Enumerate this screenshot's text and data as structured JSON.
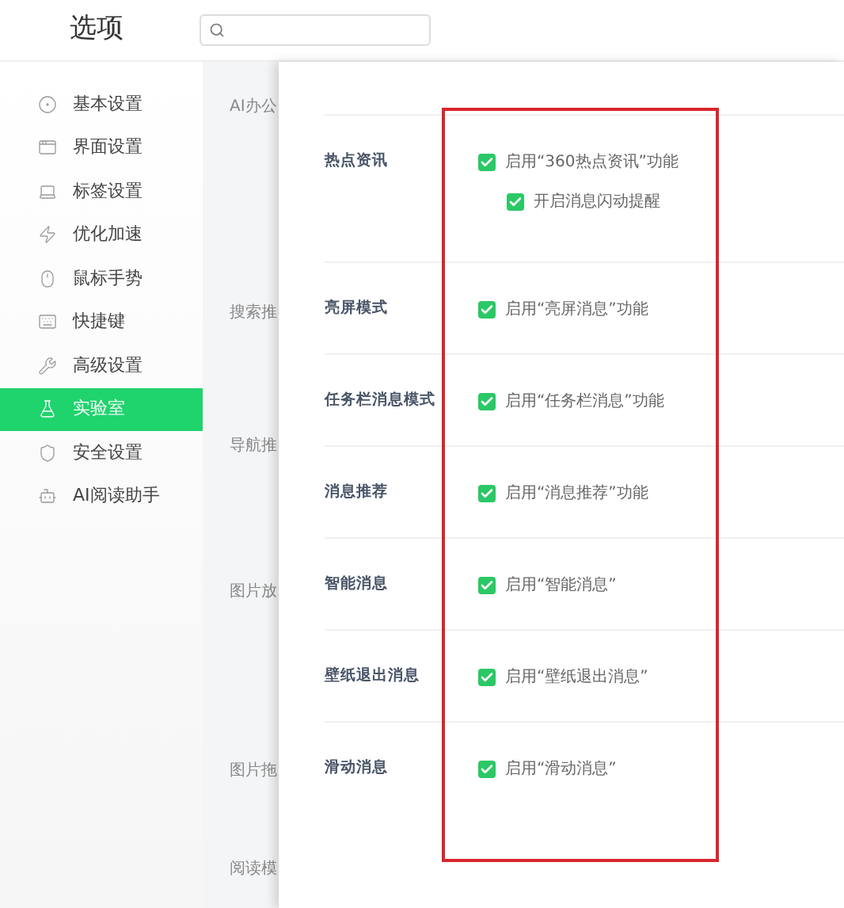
{
  "window": {
    "title": "选项"
  },
  "sidebar": {
    "items": [
      {
        "label": "基本设置",
        "selected": false
      },
      {
        "label": "界面设置",
        "selected": false
      },
      {
        "label": "标签设置",
        "selected": false
      },
      {
        "label": "优化加速",
        "selected": false
      },
      {
        "label": "鼠标手势",
        "selected": false
      },
      {
        "label": "快捷键",
        "selected": false
      },
      {
        "label": "高级设置",
        "selected": false
      },
      {
        "label": "实验室",
        "selected": true
      },
      {
        "label": "安全设置",
        "selected": false
      },
      {
        "label": "AI阅读助手",
        "selected": false
      }
    ]
  },
  "background_sections": [
    "AI办公",
    "搜索推",
    "导航推",
    "图片放",
    "图片拖",
    "阅读模"
  ],
  "lab_panel": {
    "sections": [
      {
        "label": "热点资讯",
        "options": [
          {
            "label": "启用“360热点资讯”功能",
            "checked": true,
            "children": [
              {
                "label": "开启消息闪动提醒",
                "checked": true
              }
            ]
          }
        ]
      },
      {
        "label": "亮屏模式",
        "options": [
          {
            "label": "启用“亮屏消息”功能",
            "checked": true
          }
        ]
      },
      {
        "label": "任务栏消息模式",
        "options": [
          {
            "label": "启用“任务栏消息”功能",
            "checked": true
          }
        ]
      },
      {
        "label": "消息推荐",
        "options": [
          {
            "label": "启用“消息推荐”功能",
            "checked": true
          }
        ]
      },
      {
        "label": "智能消息",
        "options": [
          {
            "label": "启用“智能消息”",
            "checked": true
          }
        ]
      },
      {
        "label": "壁纸退出消息",
        "options": [
          {
            "label": "启用“壁纸退出消息”",
            "checked": true
          }
        ]
      },
      {
        "label": "滑动消息",
        "options": [
          {
            "label": "启用“滑动消息”",
            "checked": true
          }
        ]
      }
    ]
  },
  "annotation": {
    "kind": "frame",
    "color": "#d9262c"
  }
}
